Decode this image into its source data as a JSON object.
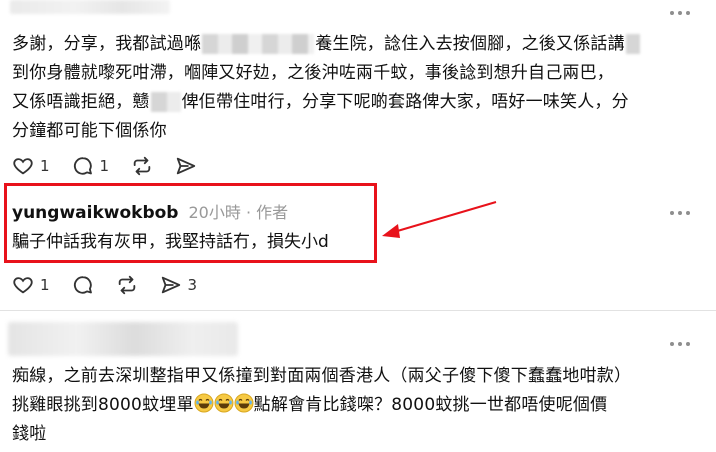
{
  "post": {
    "line1_a": "多謝，分享，我都試過喺",
    "line1_b": "養生院，諗住入去按個腳，之後又係話講",
    "line2_a": "到你身體就嚟死咁滯，嗰陣又好攰，之後沖咗兩千蚊，事後諗到想升自己兩",
    "line2_b": "巴，",
    "line3_a": "又係唔識拒絕，戆",
    "line3_b": "俾佢帶住咁行，分享下呢啲套路俾大家，唔好一味笑人，分",
    "line4": "分鐘都可能下個係你",
    "like_count": "1",
    "comment_count": "1"
  },
  "reply": {
    "username": "yungwaikwokbob",
    "time": "20小時",
    "separator": "·",
    "role": "作者",
    "text": "騙子仲話我有灰甲，我堅持話冇，損失小d",
    "like_count": "1",
    "share_count": "3"
  },
  "comment": {
    "line1": "痴線，之前去深圳整指甲又係撞到對面兩個香港人（兩父子傻下傻下蠢蠢地咁款）",
    "line2_a": "挑雞眼挑到8000蚊埋單",
    "line2_b": "點解會肯比錢㗎？8000蚊挑一世都唔使呢個價",
    "line3": "錢啦"
  },
  "colors": {
    "highlight": "#e8121b",
    "muted_text": "#999999",
    "icon": "#333333"
  },
  "icons": [
    "heart-icon",
    "comment-icon",
    "repost-icon",
    "share-icon",
    "more-icon",
    "laughing-emoji"
  ]
}
